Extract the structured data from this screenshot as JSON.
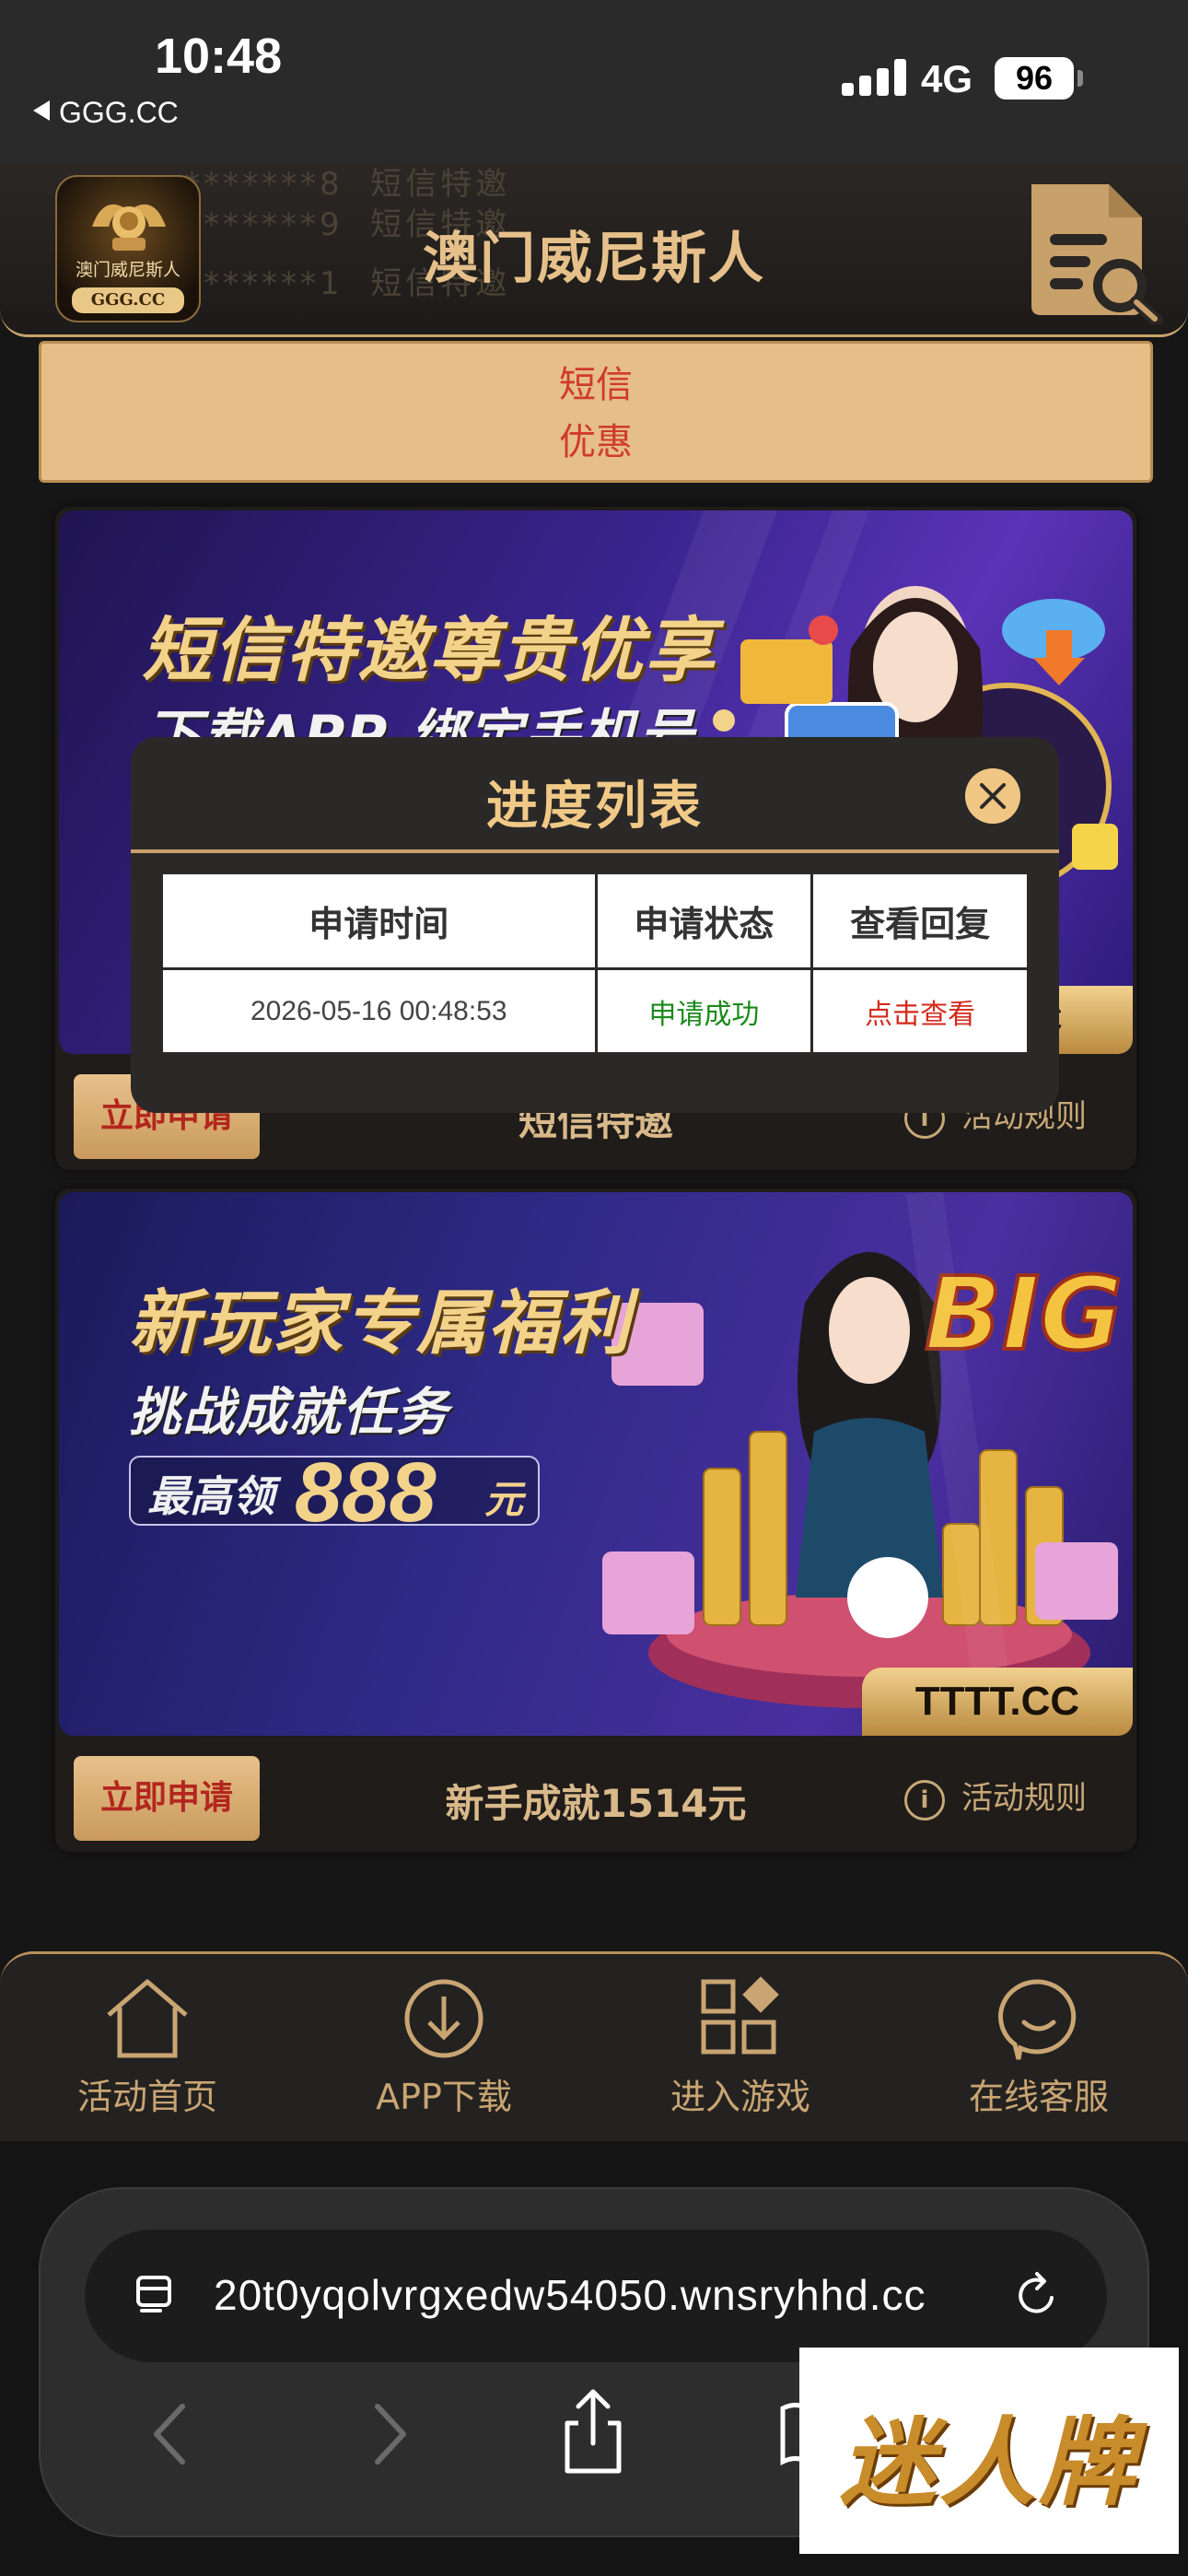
{
  "status_bar": {
    "time": "10:48",
    "back_app": "GGG.CC",
    "network": "4G",
    "battery": "96"
  },
  "header": {
    "title": "澳门威尼斯人",
    "logo_name": "澳门威尼斯人",
    "logo_domain": "GGG.CC",
    "ghost_lines": [
      "*******8",
      "*******9",
      "*******1"
    ],
    "ghost_tags": [
      "短信特邀",
      "短信特邀",
      "短信特邀"
    ]
  },
  "sms_banner": {
    "line1": "短信",
    "line2": "优惠"
  },
  "cards": [
    {
      "banner_line1": "短信特邀尊贵优享",
      "banner_line2": "下载APP 绑定手机号",
      "domain_tag": "CC",
      "apply_label": "立即申请",
      "name": "短信特邀",
      "rules_label": "活动规则"
    },
    {
      "banner_line1": "新玩家专属福利",
      "banner_line2": "挑战成就任务",
      "bonus_prefix": "最高领",
      "bonus_amount": "888",
      "bonus_unit": "元",
      "big_win": "BIG WIN",
      "domain_tag": "TTTT.CC",
      "apply_label": "立即申请",
      "name": "新手成就1514元",
      "rules_label": "活动规则"
    }
  ],
  "bottom_nav": [
    {
      "label": "活动首页",
      "icon": "home-icon"
    },
    {
      "label": "APP下载",
      "icon": "download-icon"
    },
    {
      "label": "进入游戏",
      "icon": "grid-icon"
    },
    {
      "label": "在线客服",
      "icon": "chat-icon"
    }
  ],
  "browser": {
    "url": "20t0yqolvrgxedw54050.wnsryhhd.cc"
  },
  "watermark": "迷人牌",
  "modal": {
    "title": "进度列表",
    "columns": [
      "申请时间",
      "申请状态",
      "查看回复"
    ],
    "rows": [
      {
        "time": "2026-05-16 00:48:53",
        "status": "申请成功",
        "action": "点击查看"
      }
    ]
  },
  "colors": {
    "accent_gold": "#e6c08a",
    "success_green": "#1b8a1b",
    "link_red": "#d42a1c",
    "banner_purple": "#2a1a6a"
  }
}
